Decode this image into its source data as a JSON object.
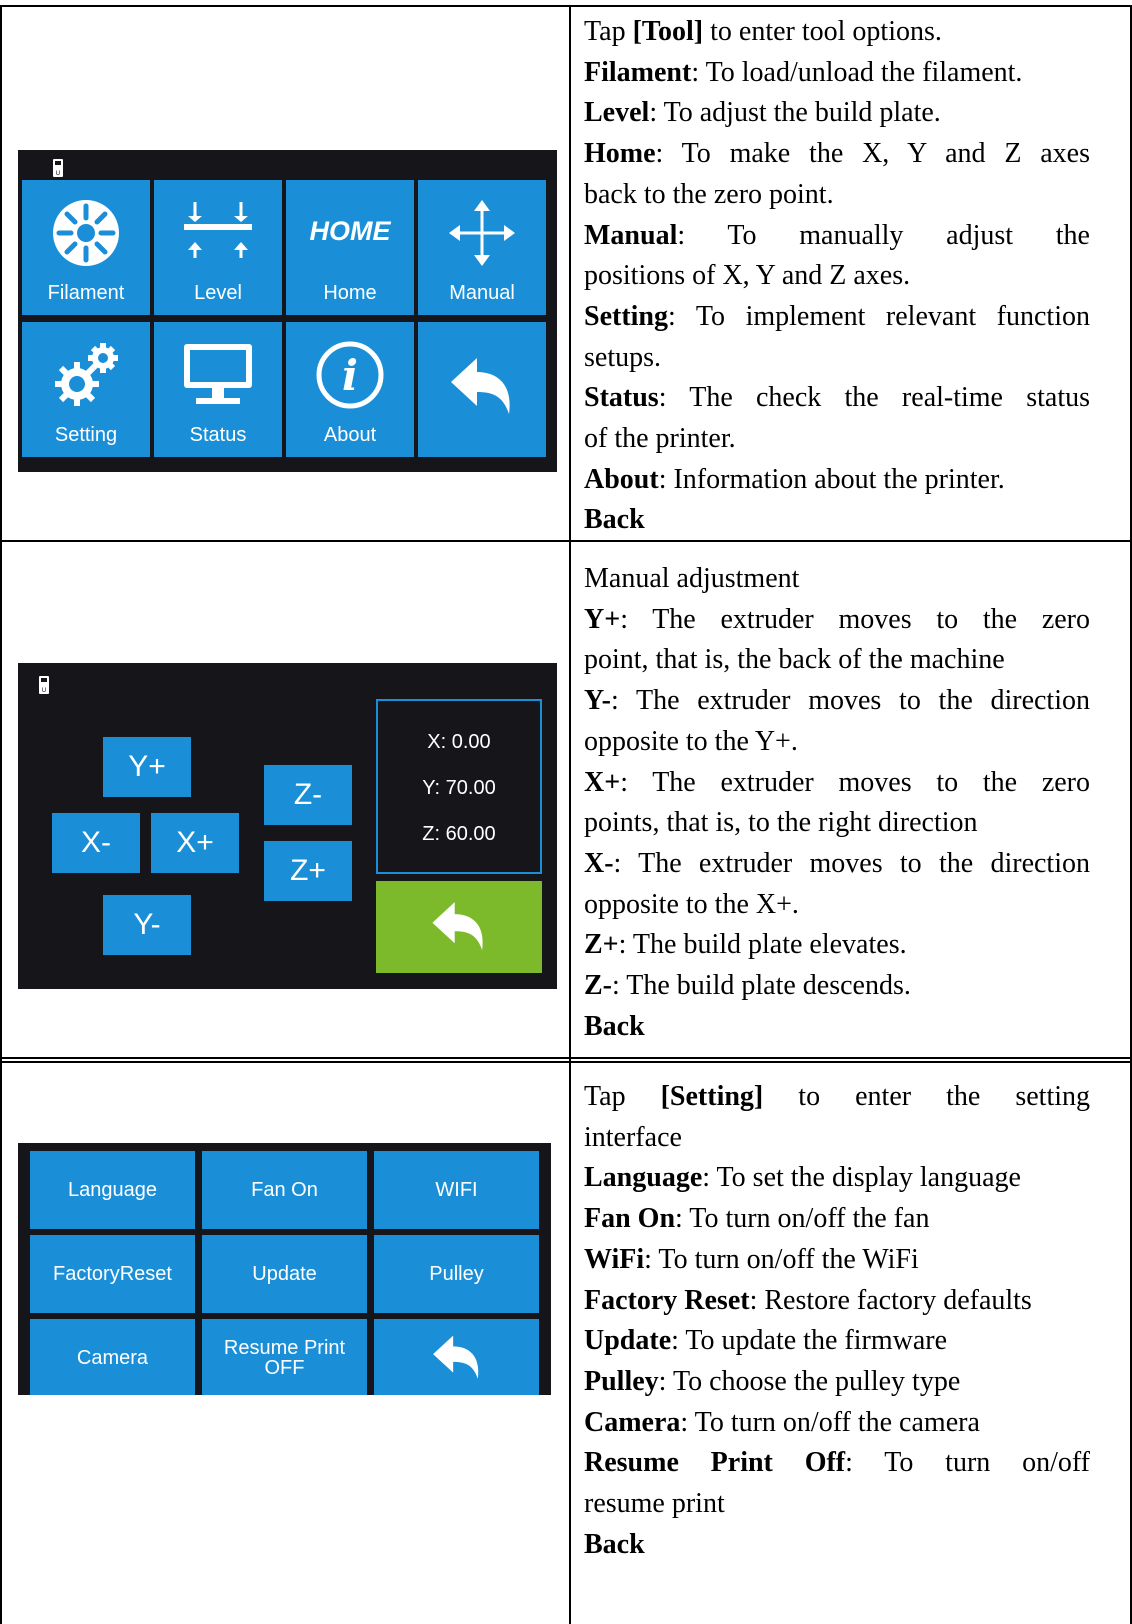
{
  "colors": {
    "tile_blue": "#1a8fd8",
    "back_green": "#7cba2b",
    "screen_bg": "#15151a"
  },
  "rows": [
    {
      "screen": {
        "tiles": [
          {
            "label": "Filament",
            "icon": "filament-icon"
          },
          {
            "label": "Level",
            "icon": "level-icon"
          },
          {
            "label": "Home",
            "icon": "home-icon",
            "icon_text": "HOME"
          },
          {
            "label": "Manual",
            "icon": "move-arrows-icon"
          },
          {
            "label": "Setting",
            "icon": "gears-icon"
          },
          {
            "label": "Status",
            "icon": "monitor-icon"
          },
          {
            "label": "About",
            "icon": "info-icon",
            "icon_text": "i"
          },
          {
            "label": "",
            "icon": "back-arrow-icon"
          }
        ]
      },
      "lines": [
        {
          "pre": "Tap ",
          "bold": "[Tool]",
          "post": " to enter tool options."
        },
        {
          "bold": "Filament",
          "post": ": To load/unload the filament."
        },
        {
          "bold": "Level",
          "post": ": To adjust the build plate."
        },
        {
          "bold": "Home",
          "post": ": To make the X, Y and Z axes"
        },
        {
          "post": "back to the zero point."
        },
        {
          "bold": "Manual",
          "post": ": To manually adjust the"
        },
        {
          "post": "positions of X, Y and Z axes."
        },
        {
          "bold": "Setting",
          "post": ": To implement relevant function"
        },
        {
          "post": "setups."
        },
        {
          "bold": "Status",
          "post": ": The check the real-time status"
        },
        {
          "post": "of the printer."
        },
        {
          "bold": "About",
          "post": ": Information about the printer."
        },
        {
          "bold": "Back"
        }
      ]
    },
    {
      "screen": {
        "buttons": {
          "y_plus": "Y+",
          "y_minus": "Y-",
          "x_minus": "X-",
          "x_plus": "X+",
          "z_minus": "Z-",
          "z_plus": "Z+"
        },
        "coords": {
          "x": "X: 0.00",
          "y": "Y: 70.00",
          "z": "Z: 60.00"
        }
      },
      "lines": [
        {
          "post": "Manual adjustment"
        },
        {
          "bold": "Y+",
          "post": ": The extruder moves to the zero"
        },
        {
          "post": "point, that is, the back of the machine"
        },
        {
          "bold": "Y-",
          "post": ": The extruder moves to the direction"
        },
        {
          "post": "opposite to the Y+."
        },
        {
          "bold": "X+",
          "post": ": The extruder moves to the zero"
        },
        {
          "post": "points, that is, to the right direction"
        },
        {
          "bold": "X-",
          "post": ": The extruder moves to the direction"
        },
        {
          "post": "opposite to the X+."
        },
        {
          "bold": "Z+",
          "post": ": The build plate elevates."
        },
        {
          "bold": "Z-",
          "post": ": The build plate descends."
        },
        {
          "bold": "Back"
        }
      ]
    },
    {
      "screen": {
        "tiles": [
          "Language",
          "Fan On",
          "WIFI",
          "FactoryReset",
          "Update",
          "Pulley",
          "Camera",
          "Resume Print",
          "OFF"
        ]
      },
      "lines": [
        {
          "pre": "Tap ",
          "bold": "[Setting]",
          "post": " to enter the setting"
        },
        {
          "post": "interface"
        },
        {
          "bold": "Language",
          "post": ": To set the display language"
        },
        {
          "bold": "Fan On",
          "post": ": To turn on/off the fan"
        },
        {
          "bold": "WiFi",
          "post": ": To turn on/off the WiFi"
        },
        {
          "bold": "Factory Reset",
          "post": ": Restore factory defaults"
        },
        {
          "bold": "Update",
          "post": ": To update the firmware"
        },
        {
          "bold": "Pulley",
          "post": ": To choose the pulley type"
        },
        {
          "bold": "Camera",
          "post": ": To turn on/off the camera"
        },
        {
          "bold": "Resume Print Off",
          "post": ": To turn on/off"
        },
        {
          "post": "resume print"
        },
        {
          "bold": "Back"
        }
      ]
    }
  ]
}
